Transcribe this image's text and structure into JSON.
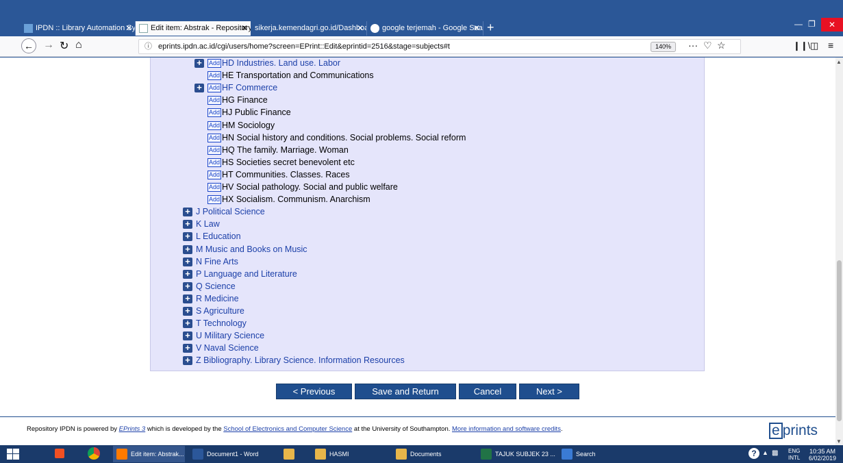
{
  "browser": {
    "tabs": [
      {
        "label": "IPDN :: Library Automation Sys",
        "active": false
      },
      {
        "label": "Edit item: Abstrak - Repository",
        "active": true
      },
      {
        "label": "sikerja.kemendagri.go.id/Dashboar",
        "active": false
      },
      {
        "label": "google terjemah - Google Sear",
        "active": false
      }
    ],
    "new_tab": "+",
    "close_glyph": "✕",
    "url": "eprints.ipdn.ac.id/cgi/users/home?screen=EPrint::Edit&eprintid=2516&stage=subjects#t",
    "zoom": "140%",
    "page_actions": "···"
  },
  "subjects": [
    {
      "add": true,
      "expand": true,
      "label": "HD Industries. Land use. Labor",
      "link": true,
      "level": 2
    },
    {
      "add": true,
      "expand": false,
      "label": "HE Transportation and Communications",
      "link": false,
      "level": 2
    },
    {
      "add": true,
      "expand": true,
      "label": "HF Commerce",
      "link": true,
      "level": 2
    },
    {
      "add": true,
      "expand": false,
      "label": "HG Finance",
      "link": false,
      "level": 2
    },
    {
      "add": true,
      "expand": false,
      "label": "HJ Public Finance",
      "link": false,
      "level": 2
    },
    {
      "add": true,
      "expand": false,
      "label": "HM Sociology",
      "link": false,
      "level": 2
    },
    {
      "add": true,
      "expand": false,
      "label": "HN Social history and conditions. Social problems. Social reform",
      "link": false,
      "level": 2
    },
    {
      "add": true,
      "expand": false,
      "label": "HQ The family. Marriage. Woman",
      "link": false,
      "level": 2
    },
    {
      "add": true,
      "expand": false,
      "label": "HS Societies secret benevolent etc",
      "link": false,
      "level": 2
    },
    {
      "add": true,
      "expand": false,
      "label": "HT Communities. Classes. Races",
      "link": false,
      "level": 2
    },
    {
      "add": true,
      "expand": false,
      "label": "HV Social pathology. Social and public welfare",
      "link": false,
      "level": 2
    },
    {
      "add": true,
      "expand": false,
      "label": "HX Socialism. Communism. Anarchism",
      "link": false,
      "level": 2
    },
    {
      "add": false,
      "expand": true,
      "label": "J Political Science",
      "link": true,
      "level": 1
    },
    {
      "add": false,
      "expand": true,
      "label": "K Law",
      "link": true,
      "level": 1
    },
    {
      "add": false,
      "expand": true,
      "label": "L Education",
      "link": true,
      "level": 1
    },
    {
      "add": false,
      "expand": true,
      "label": "M Music and Books on Music",
      "link": true,
      "level": 1
    },
    {
      "add": false,
      "expand": true,
      "label": "N Fine Arts",
      "link": true,
      "level": 1
    },
    {
      "add": false,
      "expand": true,
      "label": "P Language and Literature",
      "link": true,
      "level": 1
    },
    {
      "add": false,
      "expand": true,
      "label": "Q Science",
      "link": true,
      "level": 1
    },
    {
      "add": false,
      "expand": true,
      "label": "R Medicine",
      "link": true,
      "level": 1
    },
    {
      "add": false,
      "expand": true,
      "label": "S Agriculture",
      "link": true,
      "level": 1
    },
    {
      "add": false,
      "expand": true,
      "label": "T Technology",
      "link": true,
      "level": 1
    },
    {
      "add": false,
      "expand": true,
      "label": "U Military Science",
      "link": true,
      "level": 1
    },
    {
      "add": false,
      "expand": true,
      "label": "V Naval Science",
      "link": true,
      "level": 1
    },
    {
      "add": false,
      "expand": true,
      "label": "Z Bibliography. Library Science. Information Resources",
      "link": true,
      "level": 1
    }
  ],
  "add_label": "Add",
  "buttons": {
    "previous": "< Previous",
    "save_return": "Save and Return",
    "cancel": "Cancel",
    "next": "Next >"
  },
  "footer": {
    "t1": "Repository IPDN is powered by ",
    "eprints_link": "EPrints 3",
    "t2": " which is developed by the ",
    "school_link": "School of Electronics and Computer Science",
    "t3": " at the University of Southampton. ",
    "credits_link": "More information and software credits",
    "t4": ".",
    "logo_e": "e",
    "logo_rest": "prints"
  },
  "taskbar": {
    "items": [
      {
        "label": "Edit item: Abstrak...",
        "color": "#ff7a00"
      },
      {
        "label": "Document1 - Word",
        "color": "#2b579a"
      },
      {
        "label": "",
        "color": "#e8b64a"
      },
      {
        "label": "HASMI",
        "color": "#e8b64a"
      },
      {
        "label": "Documents",
        "color": "#e8b64a"
      },
      {
        "label": "TAJUK SUBJEK 23 ...",
        "color": "#217346"
      },
      {
        "label": "Search",
        "color": "#3a7bd5"
      }
    ],
    "lang_top": "ENG",
    "lang_bottom": "INTL",
    "time": "10:35 AM",
    "date": "6/02/2019"
  },
  "colors": {
    "accent": "#1f4e8e",
    "panel": "#e5e5fb",
    "link": "#1b3fa8"
  }
}
